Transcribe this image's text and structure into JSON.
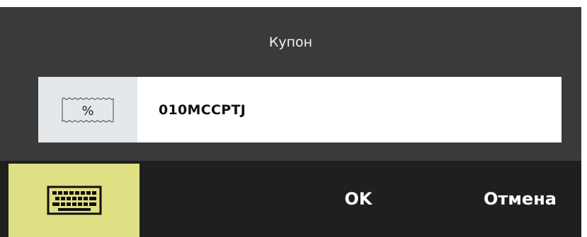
{
  "dialog": {
    "title": "Купон"
  },
  "coupon": {
    "prefix_symbol": "%",
    "prefix_icon": "coupon-ticket-icon",
    "value": "010MCCPTJ"
  },
  "toolbar": {
    "keyboard_icon": "keyboard-icon",
    "ok_label": "OK",
    "cancel_label": "Отмена"
  },
  "colors": {
    "dialog_bg": "#3a3a3a",
    "toolbar_bg": "#1f1f1f",
    "accent": "#dfe084",
    "prefix_bg": "#e5e8eb"
  }
}
